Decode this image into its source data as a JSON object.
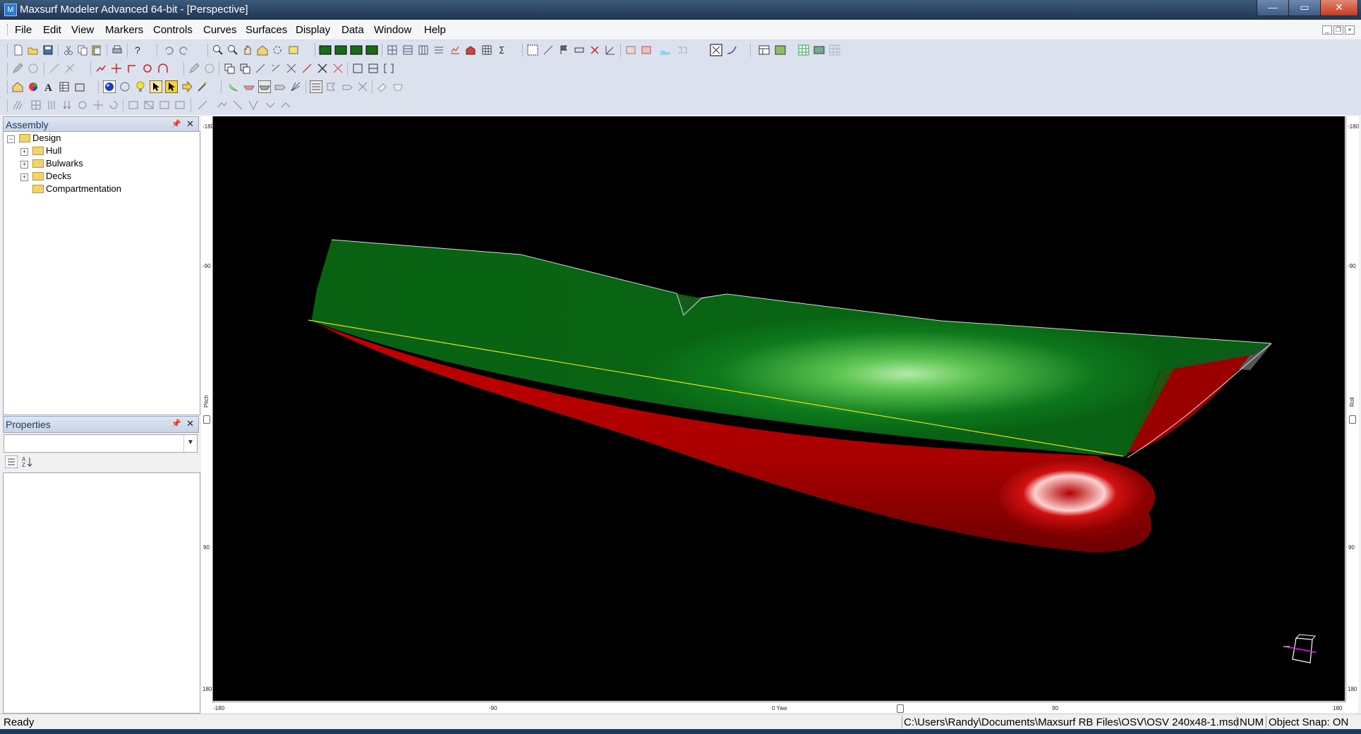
{
  "window": {
    "title": "Maxsurf Modeler Advanced 64-bit - [Perspective]",
    "controls": {
      "minimize": "—",
      "maximize": "▭",
      "close": "✕"
    }
  },
  "menu": {
    "items": [
      "File",
      "Edit",
      "View",
      "Markers",
      "Controls",
      "Curves",
      "Surfaces",
      "Display",
      "Data",
      "Window",
      "Help"
    ]
  },
  "assembly": {
    "title": "Assembly",
    "tree": {
      "root": "Design",
      "children": [
        "Hull",
        "Bulwarks",
        "Decks",
        "Compartmentation"
      ]
    }
  },
  "properties": {
    "title": "Properties",
    "combo_value": ""
  },
  "viewport": {
    "left_ruler": {
      "top": "-180",
      "upper": "-90",
      "mid": "Pitch",
      "lower": "90",
      "bottom": "180"
    },
    "right_ruler": {
      "top": "-180",
      "upper": "-90",
      "mid": "Roll",
      "lower": "90",
      "bottom": "180"
    },
    "bottom_ruler": {
      "left": "-180",
      "l90": "-90",
      "mid": "0 Yaw",
      "r90": "90",
      "right": "180"
    },
    "colors": {
      "background": "#000000",
      "topsides": "#0a6e14",
      "bottom": "#b00000",
      "deck": "#555555",
      "waterline": "#e8e000"
    }
  },
  "status": {
    "ready": "Ready",
    "file_path": "C:\\Users\\Randy\\Documents\\Maxsurf RB Files\\OSV\\OSV 240x48-1.msd",
    "num": "NUM",
    "snap": "Object Snap: ON"
  }
}
